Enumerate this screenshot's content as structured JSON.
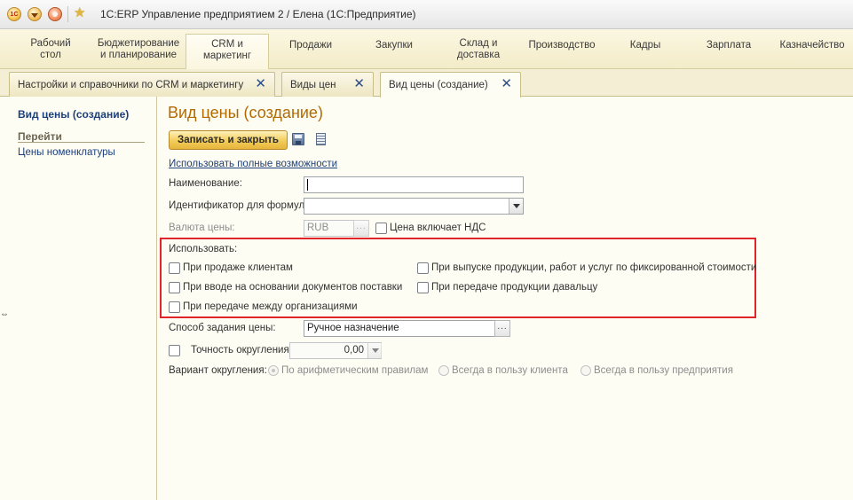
{
  "window": {
    "logo_text": "1С",
    "title": "1С:ERP Управление предприятием 2 / Елена  (1С:Предприятие)"
  },
  "sections": [
    {
      "label": "Рабочий\nстол"
    },
    {
      "label": "Бюджетирование\nи планирование"
    },
    {
      "label": "CRM и\nмаркетинг"
    },
    {
      "label": "Продажи"
    },
    {
      "label": "Закупки"
    },
    {
      "label": "Склад и\nдоставка"
    },
    {
      "label": "Производство"
    },
    {
      "label": "Кадры"
    },
    {
      "label": "Зарплата"
    },
    {
      "label": "Казначейство"
    }
  ],
  "tabs": [
    {
      "label": "Настройки и справочники по CRM и маркетингу",
      "close": "✕"
    },
    {
      "label": "Виды цен",
      "close": "✕"
    },
    {
      "label": "Вид цены (создание)",
      "close": "✕"
    }
  ],
  "nav": {
    "current": "Вид цены (создание)",
    "goto_header": "Перейти",
    "links": [
      "Цены номенклатуры"
    ]
  },
  "form": {
    "title": "Вид цены (создание)",
    "save_close": "Записать и закрыть",
    "full_features_link": "Использовать полные возможности",
    "name_label": "Наименование:",
    "name_value": "",
    "formula_id_label": "Идентификатор для формул:",
    "formula_id_value": "",
    "currency_label": "Валюта цены:",
    "currency_value": "RUB",
    "vat_included_label": "Цена включает НДС",
    "use_label": "Использовать:",
    "use_options": [
      "При продаже клиентам",
      "При выпуске продукции, работ и услуг по фиксированной стоимости",
      "При вводе на основании документов поставки",
      "При передаче продукции давальцу",
      "При передаче между организациями"
    ],
    "price_method_label": "Способ задания цены:",
    "price_method_value": "Ручное назначение",
    "rounding_label": "Точность округления:",
    "rounding_value": "0,00",
    "rounding_variant_label": "Вариант округления:",
    "rounding_variants": [
      "По арифметическим правилам",
      "Всегда в пользу клиента",
      "Всегда в пользу предприятия"
    ],
    "rounding_variant_selected": 0
  },
  "colors": {
    "accent_title": "#b26a00",
    "link": "#1d3f7a",
    "highlight_box": "#e0242a"
  }
}
